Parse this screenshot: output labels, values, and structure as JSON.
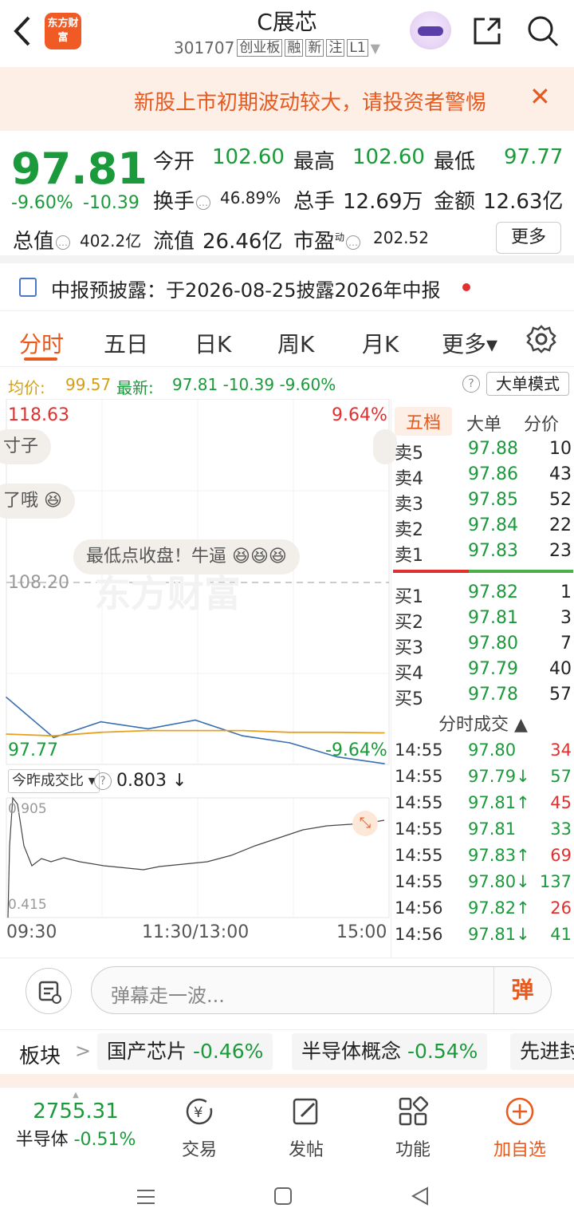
{
  "header": {
    "back_icon": "back-arrow-icon",
    "logo_text": "东方财富",
    "title": "C展芯",
    "code": "301707",
    "tags": [
      "创业板",
      "融",
      "新",
      "注",
      "L1"
    ],
    "share_icon": "share-icon",
    "search_icon": "search-icon"
  },
  "warning": {
    "text": "新股上市初期波动较大，请投资者警惕",
    "close": "✕"
  },
  "quote": {
    "price": "97.81",
    "change_pct": "-9.60%",
    "change": "-10.39",
    "open_label": "今开",
    "open_value": "102.60",
    "high_label": "最高",
    "high_value": "102.60",
    "low_label": "最低",
    "low_value": "97.77",
    "turnover_label": "换手",
    "turnover_value": "46.89%",
    "volume_label": "总手",
    "volume_value": "12.69万",
    "amount_label": "金额",
    "amount_value": "12.63亿",
    "mktcap_label": "总值",
    "mktcap_value": "402.2亿",
    "float_label": "流值",
    "float_value": "26.46亿",
    "pe_label": "市盈",
    "pe_sup": "动",
    "pe_value": "202.52",
    "more_button": "更多"
  },
  "notice": {
    "text": "中报预披露：于2026-08-25披露2026年中报"
  },
  "tabs": {
    "items": [
      "分时",
      "五日",
      "日K",
      "周K",
      "月K",
      "更多▾"
    ],
    "active": 0
  },
  "stats": {
    "avg_label": "均价:",
    "avg_value": "99.57",
    "latest_label": "最新:",
    "latest_value": "97.81  -10.39  -9.60%",
    "help": "?",
    "big_order_button": "大单模式"
  },
  "chart": {
    "top_price": "118.63",
    "top_pct": "9.64%",
    "mid_price": "108.20",
    "bottom_price": "97.77",
    "bottom_pct": "-9.64%",
    "watermark": "东方财富",
    "danmaku": [
      "寸子",
      "了哦",
      "最低点收盘！牛逼"
    ],
    "volume_ratio_label": "今昨成交比 ▾",
    "volume_ratio_value": "0.803 ↓",
    "vr_top": "0.905",
    "vr_bottom": "0.415",
    "time_labels": [
      "09:30",
      "11:30/13:00",
      "15:00"
    ],
    "colors": {
      "price_line": "#3a6fb0",
      "avg_line": "#e8a020",
      "down": "#1a9a3a",
      "up": "#e03030"
    }
  },
  "chart_data": {
    "type": "line",
    "x": [
      "09:30",
      "10:00",
      "10:30",
      "11:00",
      "11:30/13:00",
      "13:30",
      "14:00",
      "14:30",
      "15:00"
    ],
    "series": [
      {
        "name": "最新",
        "values": [
          101.6,
          99.3,
          100.2,
          99.8,
          100.3,
          99.4,
          99.0,
          98.2,
          97.81
        ]
      },
      {
        "name": "均价",
        "values": [
          99.5,
          99.4,
          99.6,
          99.7,
          99.7,
          99.7,
          99.6,
          99.6,
          99.57
        ]
      }
    ],
    "ylim": [
      97.77,
      118.63
    ]
  },
  "orderbook": {
    "tabs": [
      "五档",
      "大单",
      "分价"
    ],
    "asks": [
      {
        "label": "卖5",
        "price": "97.88",
        "vol": "10"
      },
      {
        "label": "卖4",
        "price": "97.86",
        "vol": "43"
      },
      {
        "label": "卖3",
        "price": "97.85",
        "vol": "52"
      },
      {
        "label": "卖2",
        "price": "97.84",
        "vol": "22"
      },
      {
        "label": "卖1",
        "price": "97.83",
        "vol": "23"
      }
    ],
    "bids": [
      {
        "label": "买1",
        "price": "97.82",
        "vol": "1"
      },
      {
        "label": "买2",
        "price": "97.81",
        "vol": "3"
      },
      {
        "label": "买3",
        "price": "97.80",
        "vol": "7"
      },
      {
        "label": "买4",
        "price": "97.79",
        "vol": "40"
      },
      {
        "label": "买5",
        "price": "97.78",
        "vol": "57"
      }
    ],
    "trades_title": "分时成交 ▲",
    "trades": [
      {
        "time": "14:55",
        "price": "97.80",
        "vol": "34",
        "dir": "up"
      },
      {
        "time": "14:55",
        "price": "97.79↓",
        "vol": "57",
        "dir": "down"
      },
      {
        "time": "14:55",
        "price": "97.81↑",
        "vol": "45",
        "dir": "up"
      },
      {
        "time": "14:55",
        "price": "97.81",
        "vol": "33",
        "dir": "down"
      },
      {
        "time": "14:55",
        "price": "97.83↑",
        "vol": "69",
        "dir": "up"
      },
      {
        "time": "14:55",
        "price": "97.80↓",
        "vol": "137",
        "dir": "down"
      },
      {
        "time": "14:56",
        "price": "97.82↑",
        "vol": "26",
        "dir": "up"
      },
      {
        "time": "14:56",
        "price": "97.81↓",
        "vol": "41",
        "dir": "down"
      }
    ]
  },
  "comment": {
    "placeholder": "弹幕走一波...",
    "danmaku_button": "弹"
  },
  "sectors": {
    "label": "板块",
    "items": [
      {
        "name": "国产芯片",
        "change": "-0.46%"
      },
      {
        "name": "半导体概念",
        "change": "-0.54%"
      },
      {
        "name": "先进封",
        "change": ""
      }
    ]
  },
  "bottom_nav": {
    "index_value": "2755.31",
    "index_name": "半导体",
    "index_change": "-0.51%",
    "items": [
      "交易",
      "发帖",
      "功能",
      "加自选"
    ]
  }
}
